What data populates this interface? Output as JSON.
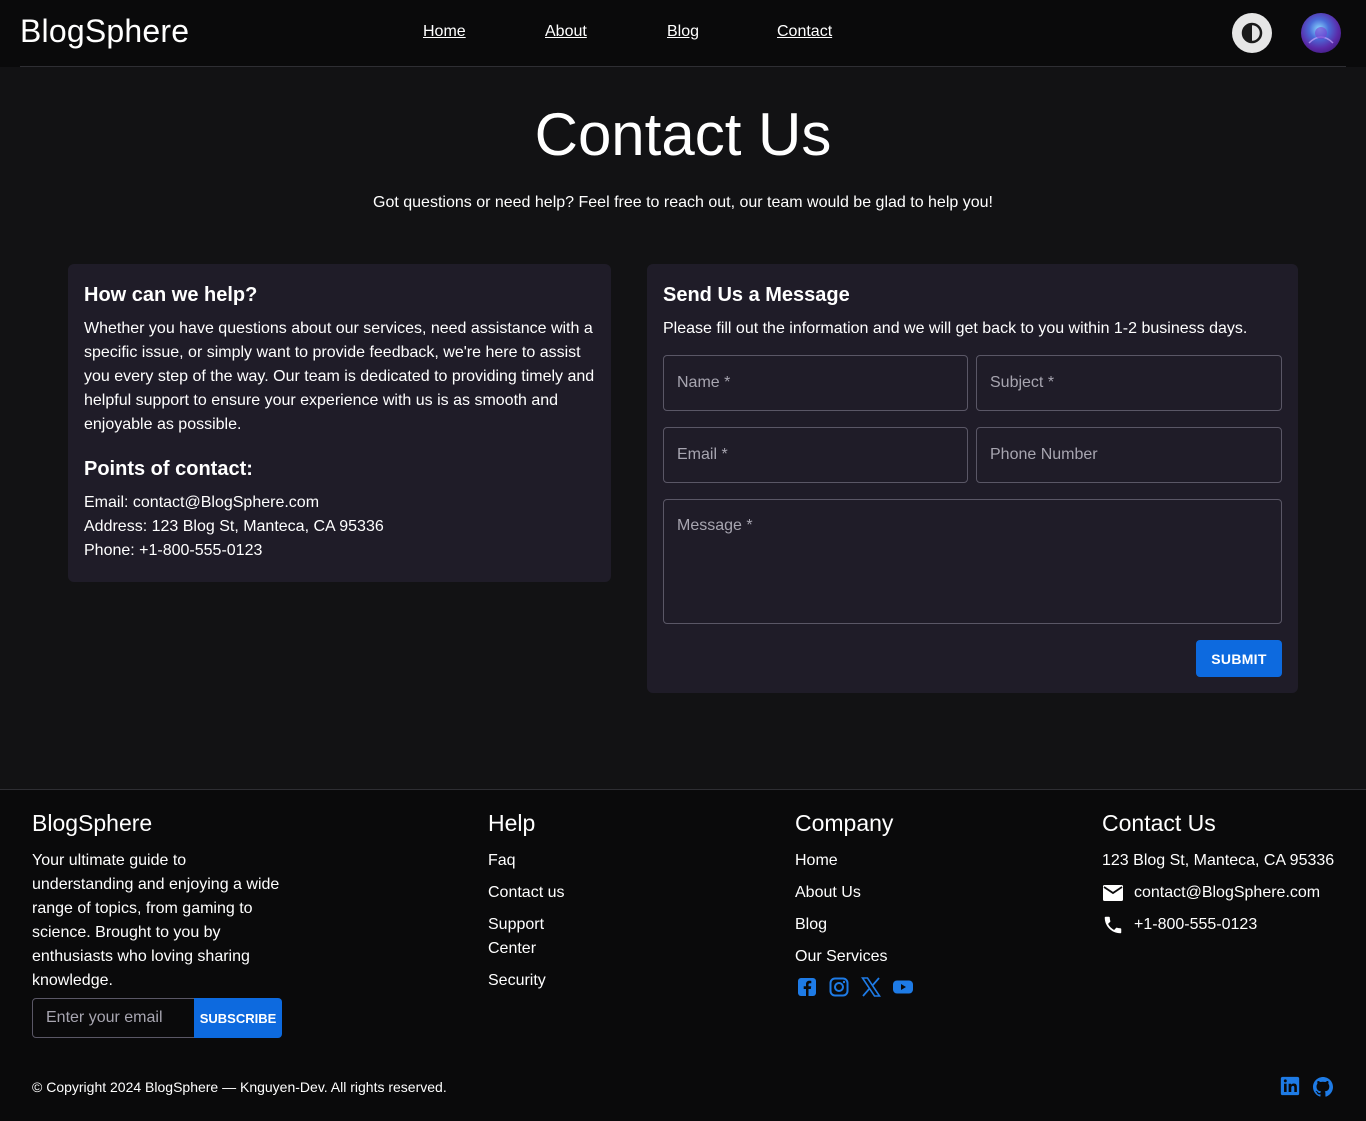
{
  "header": {
    "logo": "BlogSphere",
    "nav": [
      "Home",
      "About",
      "Blog",
      "Contact"
    ],
    "theme_toggle_icon": "contrast-icon",
    "avatar_icon": "avatar"
  },
  "hero": {
    "title": "Contact Us",
    "subtitle": "Got questions or need help? Feel free to reach out, our team would be glad to help you!"
  },
  "help_card": {
    "title": "How can we help?",
    "body": "Whether you have questions about our services, need assistance with a specific issue, or simply want to provide feedback, we're here to assist you every step of the way. Our team is dedicated to providing timely and helpful support to ensure your experience with us is as smooth and enjoyable as possible.",
    "points_title": "Points of contact:",
    "email": "Email: contact@BlogSphere.com",
    "address": "Address: 123 Blog St, Manteca, CA 95336",
    "phone": "Phone: +1-800-555-0123"
  },
  "form_card": {
    "title": "Send Us a Message",
    "subtitle": "Please fill out the information and we will get back to you within 1-2 business days.",
    "name_placeholder": "Name *",
    "subject_placeholder": "Subject *",
    "email_placeholder": "Email *",
    "phone_placeholder": "Phone Number",
    "message_placeholder": "Message *",
    "submit_label": "SUBMIT"
  },
  "footer": {
    "brand": "BlogSphere",
    "description": "Your ultimate guide to understanding and enjoying a wide range of topics, from gaming to science. Brought to you by enthusiasts who loving sharing knowledge.",
    "subscribe_placeholder": "Enter your email",
    "subscribe_label": "SUBSCRIBE",
    "help_title": "Help",
    "help_links": [
      "Faq",
      "Contact us",
      "Support Center",
      "Security"
    ],
    "company_title": "Company",
    "company_links": [
      "Home",
      "About Us",
      "Blog",
      "Our Services"
    ],
    "contact_title": "Contact Us",
    "contact_address": "123 Blog St, Manteca, CA 95336",
    "contact_email": "contact@BlogSphere.com",
    "contact_phone": "+1-800-555-0123",
    "social_icons": [
      "facebook-icon",
      "instagram-icon",
      "x-icon",
      "youtube-icon"
    ],
    "bottom_icons": [
      "linkedin-icon",
      "github-icon"
    ],
    "copyright": "© Copyright 2024 BlogSphere — Knguyen-Dev. All rights reserved."
  },
  "colors": {
    "accent": "#0d6adf",
    "card": "#1f1c28",
    "background": "#121214"
  }
}
